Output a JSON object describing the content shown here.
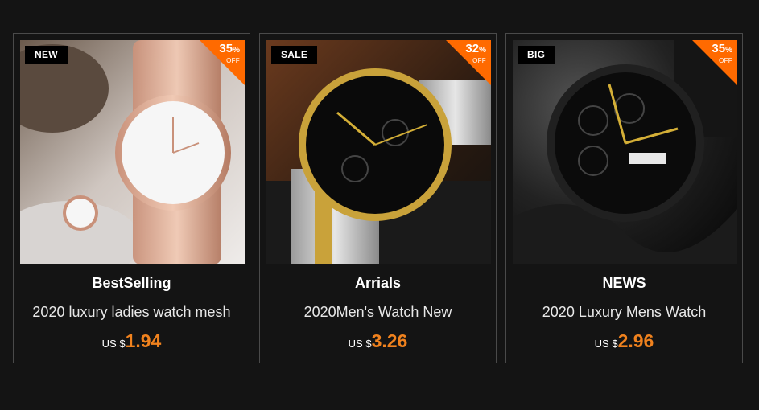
{
  "accent_color": "#f0821e",
  "discount_color": "#ff6a00",
  "products": [
    {
      "tag": "NEW",
      "discount": "35",
      "discount_unit": "%",
      "off_label": "OFF",
      "name": "BestSelling",
      "description": "2020 luxury ladies watch mesh",
      "currency": "US $",
      "price": "1.94",
      "image_icon": "rose-gold-mesh-watch-photo"
    },
    {
      "tag": "SALE",
      "discount": "32",
      "discount_unit": "%",
      "off_label": "OFF",
      "name": "Arrials",
      "description": "2020Men's Watch New",
      "currency": "US $",
      "price": "3.26",
      "image_icon": "gold-steel-chronograph-photo"
    },
    {
      "tag": "BIG",
      "discount": "35",
      "discount_unit": "%",
      "off_label": "OFF",
      "name": "NEWS",
      "description": "2020 Luxury Mens Watch",
      "currency": "US $",
      "price": "2.96",
      "image_icon": "black-leather-chronograph-photo"
    }
  ]
}
